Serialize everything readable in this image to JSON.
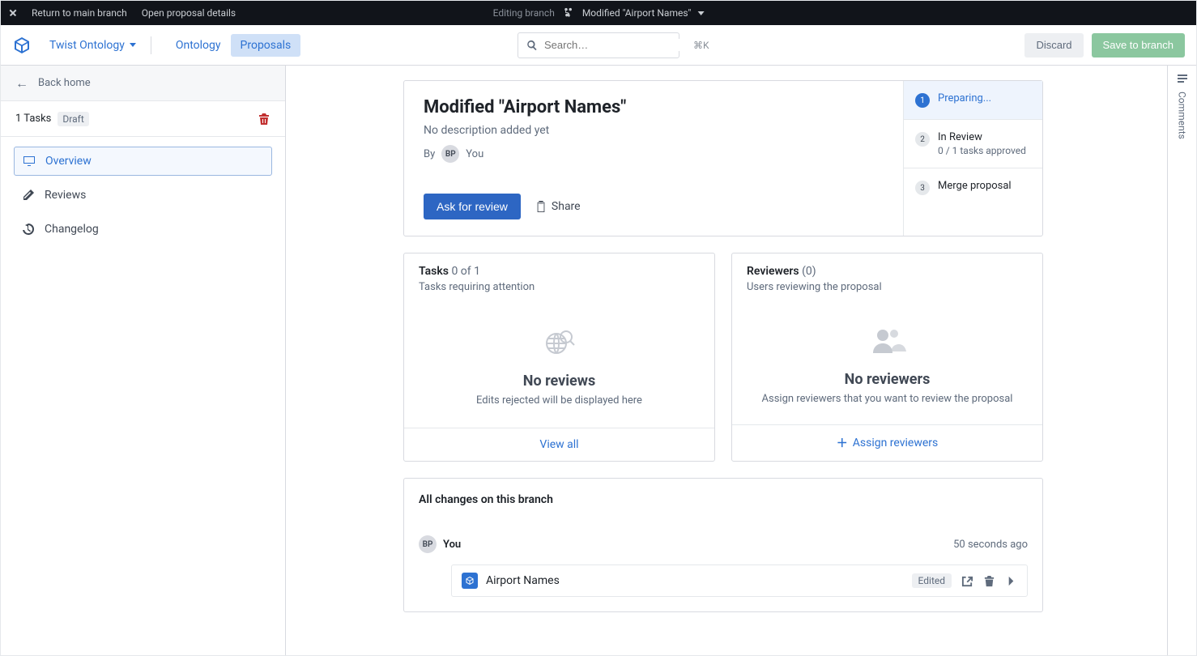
{
  "topbar": {
    "return_label": "Return to main branch",
    "open_details_label": "Open proposal details",
    "editing_label": "Editing branch",
    "branch_name": "Modified \"Airport Names\""
  },
  "header": {
    "workspace_name": "Twist Ontology",
    "tabs": {
      "ontology": "Ontology",
      "proposals": "Proposals"
    },
    "search_placeholder": "Search…",
    "search_kbd": "⌘K",
    "discard_label": "Discard",
    "save_label": "Save to branch"
  },
  "sidebar": {
    "back_label": "Back home",
    "tasks_count_label": "1 Tasks",
    "draft_badge": "Draft",
    "items": {
      "overview": "Overview",
      "reviews": "Reviews",
      "changelog": "Changelog"
    }
  },
  "hero": {
    "title": "Modified \"Airport Names\"",
    "subtitle": "No description added yet",
    "by_label": "By",
    "avatar_initials": "BP",
    "you_label": "You",
    "ask_review_label": "Ask for review",
    "share_label": "Share"
  },
  "steps": [
    {
      "title": "Preparing...",
      "sub": ""
    },
    {
      "title": "In Review",
      "sub": "0 / 1 tasks approved"
    },
    {
      "title": "Merge proposal",
      "sub": ""
    }
  ],
  "tasks_panel": {
    "title": "Tasks",
    "count": "0 of 1",
    "subtitle": "Tasks requiring attention",
    "empty_title": "No reviews",
    "empty_sub": "Edits rejected will be displayed here",
    "footer_link": "View all"
  },
  "reviewers_panel": {
    "title": "Reviewers",
    "count": "(0)",
    "subtitle": "Users reviewing the proposal",
    "empty_title": "No reviewers",
    "empty_sub": "Assign reviewers that you want to review the proposal",
    "footer_link": "Assign reviewers"
  },
  "changes": {
    "title": "All changes on this branch",
    "author_initials": "BP",
    "author_label": "You",
    "time_label": "50 seconds ago",
    "item_name": "Airport Names",
    "edited_badge": "Edited"
  },
  "rail": {
    "comments_label": "Comments"
  }
}
